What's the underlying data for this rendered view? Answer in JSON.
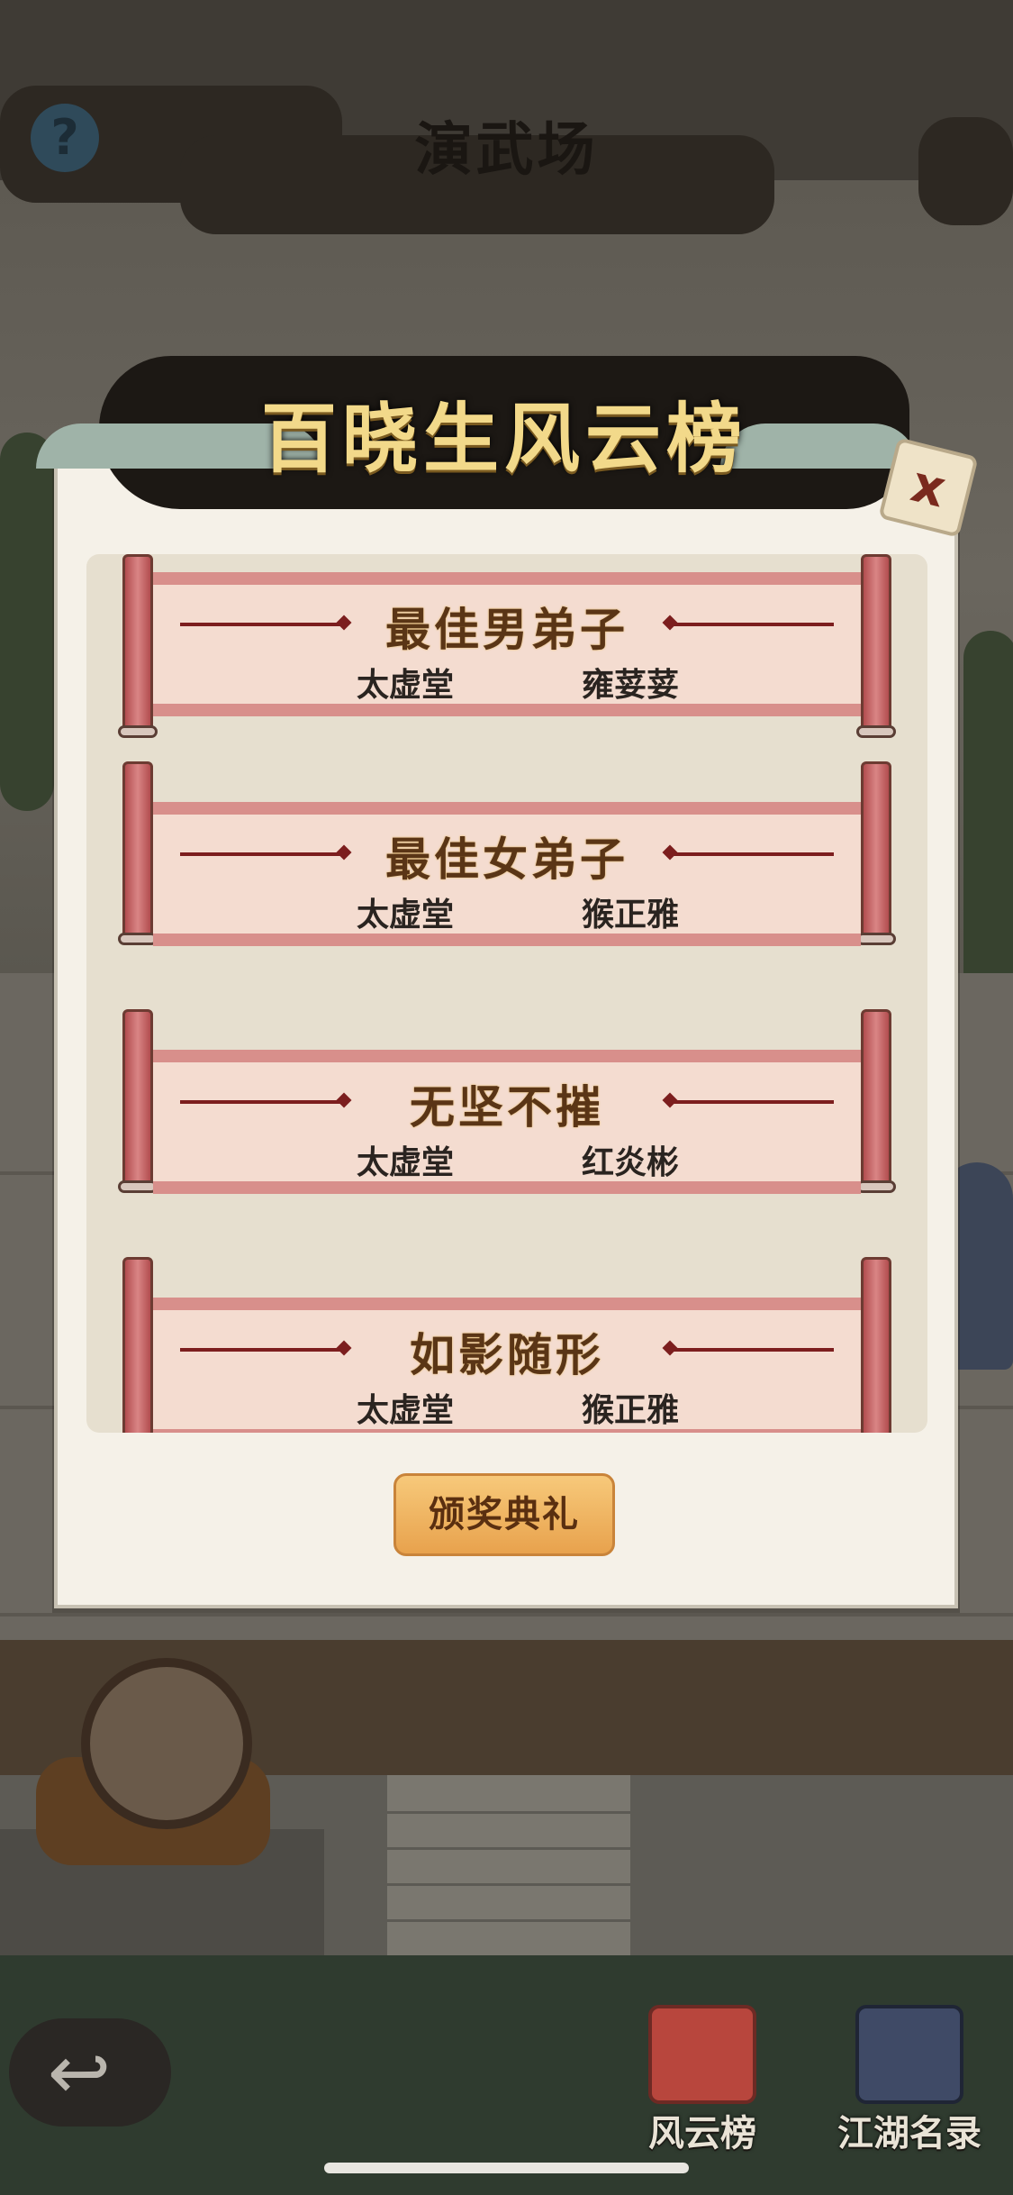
{
  "header": {
    "title": "演武场",
    "help_icon": "?"
  },
  "modal": {
    "title": "百晓生风云榜",
    "close_icon": "x",
    "awards": [
      {
        "award": "最佳男弟子",
        "school": "太虚堂",
        "winner": "雍荽荽"
      },
      {
        "award": "最佳女弟子",
        "school": "太虚堂",
        "winner": "猴正雅"
      },
      {
        "award": "无坚不摧",
        "school": "太虚堂",
        "winner": "红炎彬"
      },
      {
        "award": "如影随形",
        "school": "太虚堂",
        "winner": "猴正雅"
      }
    ],
    "ceremony_button": "颁奖典礼"
  },
  "bottom_nav": {
    "back_icon": "↩",
    "items": [
      {
        "label": "风云榜"
      },
      {
        "label": "江湖名录"
      }
    ]
  }
}
